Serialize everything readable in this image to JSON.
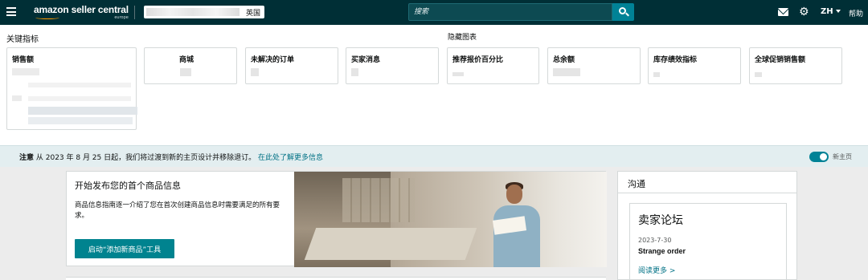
{
  "nav": {
    "logo_text": "amazon seller central",
    "logo_sub": "europe",
    "marketplace_country": "英国",
    "search_placeholder": "搜索",
    "language": "ZH",
    "help": "帮助"
  },
  "metrics": {
    "section_title": "关键指标",
    "hidden_charts": "隐藏图表",
    "cards": [
      {
        "label": "销售额"
      },
      {
        "label": "商城"
      },
      {
        "label": "未解决的订单"
      },
      {
        "label": "买家消息"
      },
      {
        "label": "推荐报价百分比"
      },
      {
        "label": "总余额"
      },
      {
        "label": "库存绩效指标"
      },
      {
        "label": "全球促销销售额"
      }
    ]
  },
  "notice": {
    "prefix": "注意",
    "message": " 从 2023 年 8 月 25 日起，我们将过渡到新的主页设计并移除退订。",
    "link": "在此处了解更多信息",
    "toggle_label": "新主页"
  },
  "onboarding": {
    "title": "开始发布您的首个商品信息",
    "description": "商品信息指南逐一介绍了您在首次创建商品信息时需要满足的所有要求。",
    "button": "启动“添加新商品”工具"
  },
  "communication": {
    "title": "沟通",
    "forum_title": "卖家论坛",
    "post_date": "2023-7-30",
    "post_title": "Strange order",
    "read_more": "阅读更多 >"
  },
  "colors": {
    "nav_bg": "#002f36",
    "accent": "#008296",
    "link": "#007185",
    "notice_bg": "#e3eef0"
  }
}
